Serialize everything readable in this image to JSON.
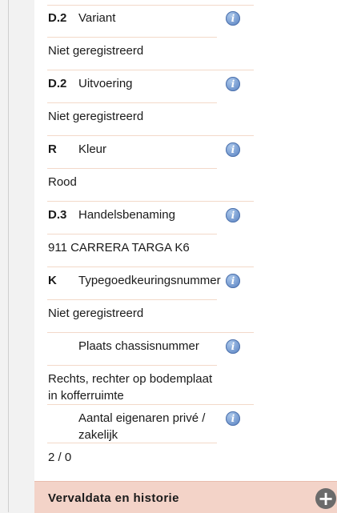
{
  "rows": [
    {
      "code": "D.2",
      "label": "Variant",
      "value": "Niet geregistreerd",
      "icon": "info-icon"
    },
    {
      "code": "D.2",
      "label": "Uitvoering",
      "value": "Niet geregistreerd",
      "icon": "info-icon"
    },
    {
      "code": "R",
      "label": "Kleur",
      "value": "Rood",
      "icon": "info-icon"
    },
    {
      "code": "D.3",
      "label": "Handelsbenaming",
      "value": "911 CARRERA TARGA K6",
      "icon": "info-icon"
    },
    {
      "code": "K",
      "label": "Typegoedkeuringsnummer",
      "value": "Niet geregistreerd",
      "icon": "info-icon"
    },
    {
      "code": "",
      "label": "Plaats chassisnummer",
      "value_line1": "Rechts, rechter op bodemplaat",
      "value_line2": "in kofferruimte",
      "icon": "info-icon"
    },
    {
      "code": "",
      "label_line1": "Aantal eigenaren privé /",
      "label_line2": "zakelijk",
      "value": "2 / 0",
      "icon": "info-icon"
    }
  ],
  "footer": {
    "title": "Vervaldata en historie",
    "expand_icon": "plus-circle-icon"
  },
  "colors": {
    "separator": "#f3d9c9",
    "footer_bg": "#f3d3c8",
    "info": "#6d93cc"
  }
}
